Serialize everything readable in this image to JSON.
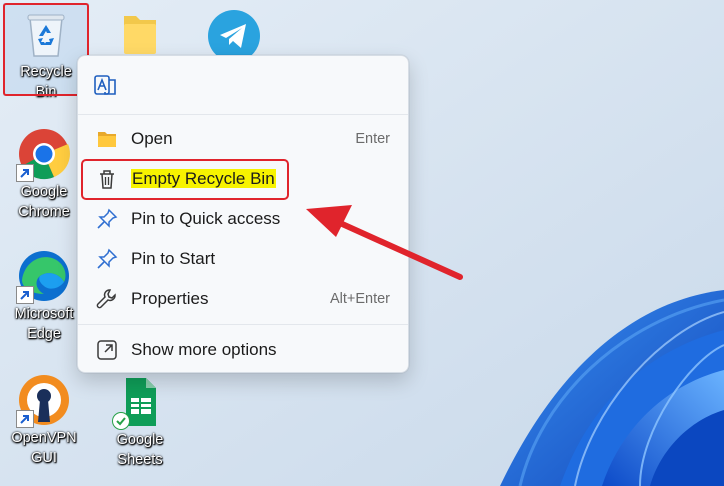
{
  "desktop": {
    "icons": [
      {
        "label": "Recycle Bin",
        "icon": "recycle-bin-icon"
      },
      {
        "label": "",
        "icon": "folder-icon"
      },
      {
        "label": "",
        "icon": "telegram-icon"
      },
      {
        "label": "Google\nChrome",
        "icon": "chrome-icon"
      },
      {
        "label": "Microsoft\nEdge",
        "icon": "edge-icon"
      },
      {
        "label": "OpenVPN\nGUI",
        "icon": "openvpn-icon"
      },
      {
        "label": "Google\nSheets",
        "icon": "google-sheets-icon"
      }
    ]
  },
  "context_menu": {
    "top_icon": "translate-icon",
    "items": [
      {
        "label": "Open",
        "shortcut": "Enter",
        "icon": "folder-icon"
      },
      {
        "label": "Empty Recycle Bin",
        "shortcut": "",
        "icon": "trash-icon",
        "highlighted": true
      },
      {
        "label": "Pin to Quick access",
        "shortcut": "",
        "icon": "pin-icon"
      },
      {
        "label": "Pin to Start",
        "shortcut": "",
        "icon": "pin-icon"
      },
      {
        "label": "Properties",
        "shortcut": "Alt+Enter",
        "icon": "wrench-icon"
      },
      {
        "label": "Show more options",
        "shortcut": "",
        "icon": "show-more-icon"
      }
    ]
  },
  "colors": {
    "highlight": "#f7f300",
    "annotation_red": "#e0242c",
    "windows_blue": "#0a5bd6"
  }
}
